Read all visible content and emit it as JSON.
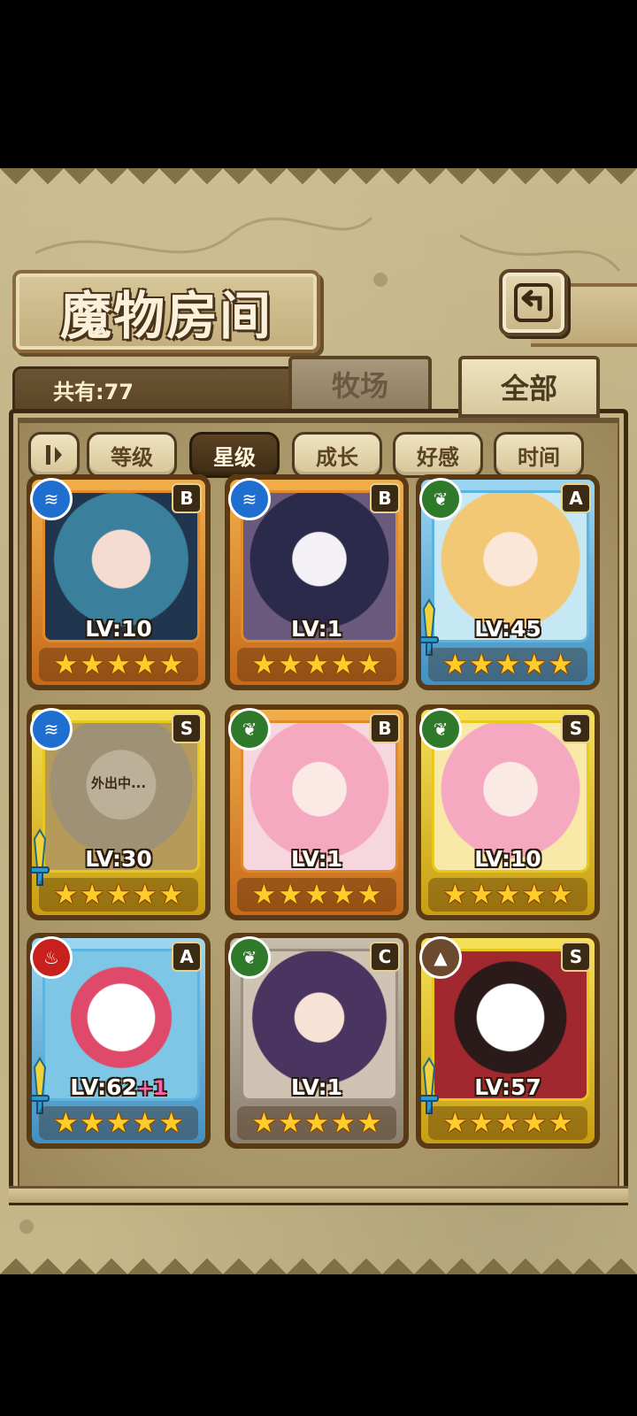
{
  "header": {
    "title": "魔物房间",
    "back_icon": "return-arrow-icon"
  },
  "counter": {
    "label": "共有:77"
  },
  "tabs": [
    {
      "label": "牧场",
      "active": false
    },
    {
      "label": "全部",
      "active": true
    }
  ],
  "sort": {
    "toggle_icon": "sort-toggle-icon",
    "buttons": [
      {
        "label": "等级",
        "active": false
      },
      {
        "label": "星级",
        "active": true
      },
      {
        "label": "成长",
        "active": false
      },
      {
        "label": "好感",
        "active": false
      },
      {
        "label": "时间",
        "active": false
      }
    ]
  },
  "monsters": [
    {
      "element": "water",
      "rank": "B",
      "level": "LV:10",
      "bonus": "",
      "stars": 5,
      "frame": "orange",
      "equipped": false,
      "away": ""
    },
    {
      "element": "water",
      "rank": "B",
      "level": "LV:1",
      "bonus": "",
      "stars": 5,
      "frame": "orange",
      "equipped": false,
      "away": ""
    },
    {
      "element": "nature",
      "rank": "A",
      "level": "LV:45",
      "bonus": "",
      "stars": 5,
      "frame": "blue",
      "equipped": true,
      "away": ""
    },
    {
      "element": "water",
      "rank": "S",
      "level": "LV:30",
      "bonus": "",
      "stars": 5,
      "frame": "gold",
      "equipped": true,
      "away": "外出中..."
    },
    {
      "element": "nature",
      "rank": "B",
      "level": "LV:1",
      "bonus": "",
      "stars": 5,
      "frame": "orange",
      "equipped": false,
      "away": ""
    },
    {
      "element": "nature",
      "rank": "S",
      "level": "LV:10",
      "bonus": "",
      "stars": 5,
      "frame": "gold",
      "equipped": false,
      "away": ""
    },
    {
      "element": "fire",
      "rank": "A",
      "level": "LV:62",
      "bonus": "+1",
      "stars": 5,
      "frame": "blue",
      "equipped": true,
      "away": ""
    },
    {
      "element": "nature",
      "rank": "C",
      "level": "LV:1",
      "bonus": "",
      "stars": 5,
      "frame": "gray",
      "equipped": false,
      "away": ""
    },
    {
      "element": "earth",
      "rank": "S",
      "level": "LV:57",
      "bonus": "",
      "stars": 5,
      "frame": "gold",
      "equipped": true,
      "away": ""
    }
  ],
  "colors": {
    "water": "#1e6fd0",
    "nature": "#2e7a2a",
    "fire": "#c8201c",
    "earth": "#6b4a2e",
    "frame_orange": "#e08a2a",
    "frame_blue": "#5bb3e0",
    "frame_gold": "#e8c81e",
    "frame_gray": "#9a8f80",
    "star": "#ffcd2a"
  }
}
